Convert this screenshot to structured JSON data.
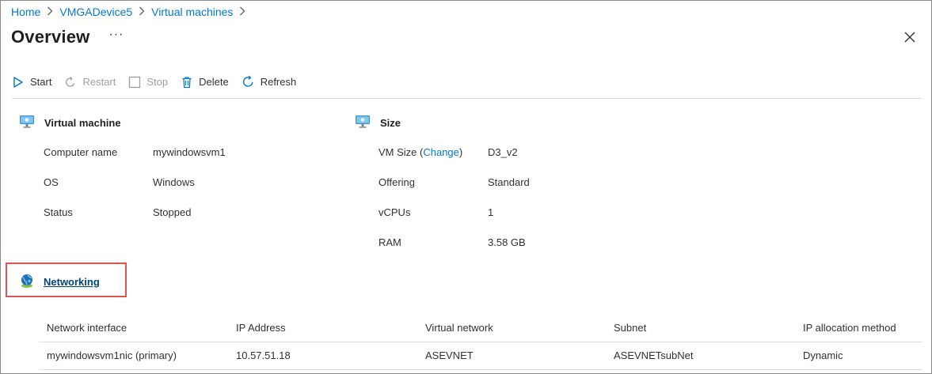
{
  "breadcrumb": {
    "items": [
      "Home",
      "VMGADevice5",
      "Virtual machines"
    ],
    "separator": ">"
  },
  "header": {
    "title": "Overview",
    "more": "···"
  },
  "toolbar": {
    "start": "Start",
    "restart": "Restart",
    "stop": "Stop",
    "delete": "Delete",
    "refresh": "Refresh"
  },
  "vm": {
    "heading": "Virtual machine",
    "rows": [
      {
        "label": "Computer name",
        "value": "mywindowsvm1"
      },
      {
        "label": "OS",
        "value": "Windows"
      },
      {
        "label": "Status",
        "value": "Stopped"
      }
    ]
  },
  "size": {
    "heading": "Size",
    "vm_size_label_prefix": "VM Size (",
    "change_link": "Change",
    "vm_size_label_suffix": ")",
    "vm_size_value": "D3_v2",
    "rows": [
      {
        "label": "Offering",
        "value": "Standard"
      },
      {
        "label": "vCPUs",
        "value": "1"
      },
      {
        "label": "RAM",
        "value": "3.58 GB"
      }
    ]
  },
  "networking": {
    "heading": "Networking",
    "columns": [
      "Network interface",
      "IP Address",
      "Virtual network",
      "Subnet",
      "IP allocation method"
    ],
    "rows": [
      [
        "mywindowsvm1nic (primary)",
        "10.57.51.18",
        "ASEVNET",
        "ASEVNETsubNet",
        "Dynamic"
      ]
    ]
  },
  "colors": {
    "link": "#0078d4",
    "highlight_border": "#e05353",
    "disabled_text": "#a19f9d"
  },
  "icons": [
    "chevron-right-icon",
    "more-icon",
    "close-icon",
    "play-icon",
    "restart-icon",
    "stop-icon",
    "delete-icon",
    "refresh-icon",
    "monitor-icon",
    "globe-network-icon"
  ]
}
